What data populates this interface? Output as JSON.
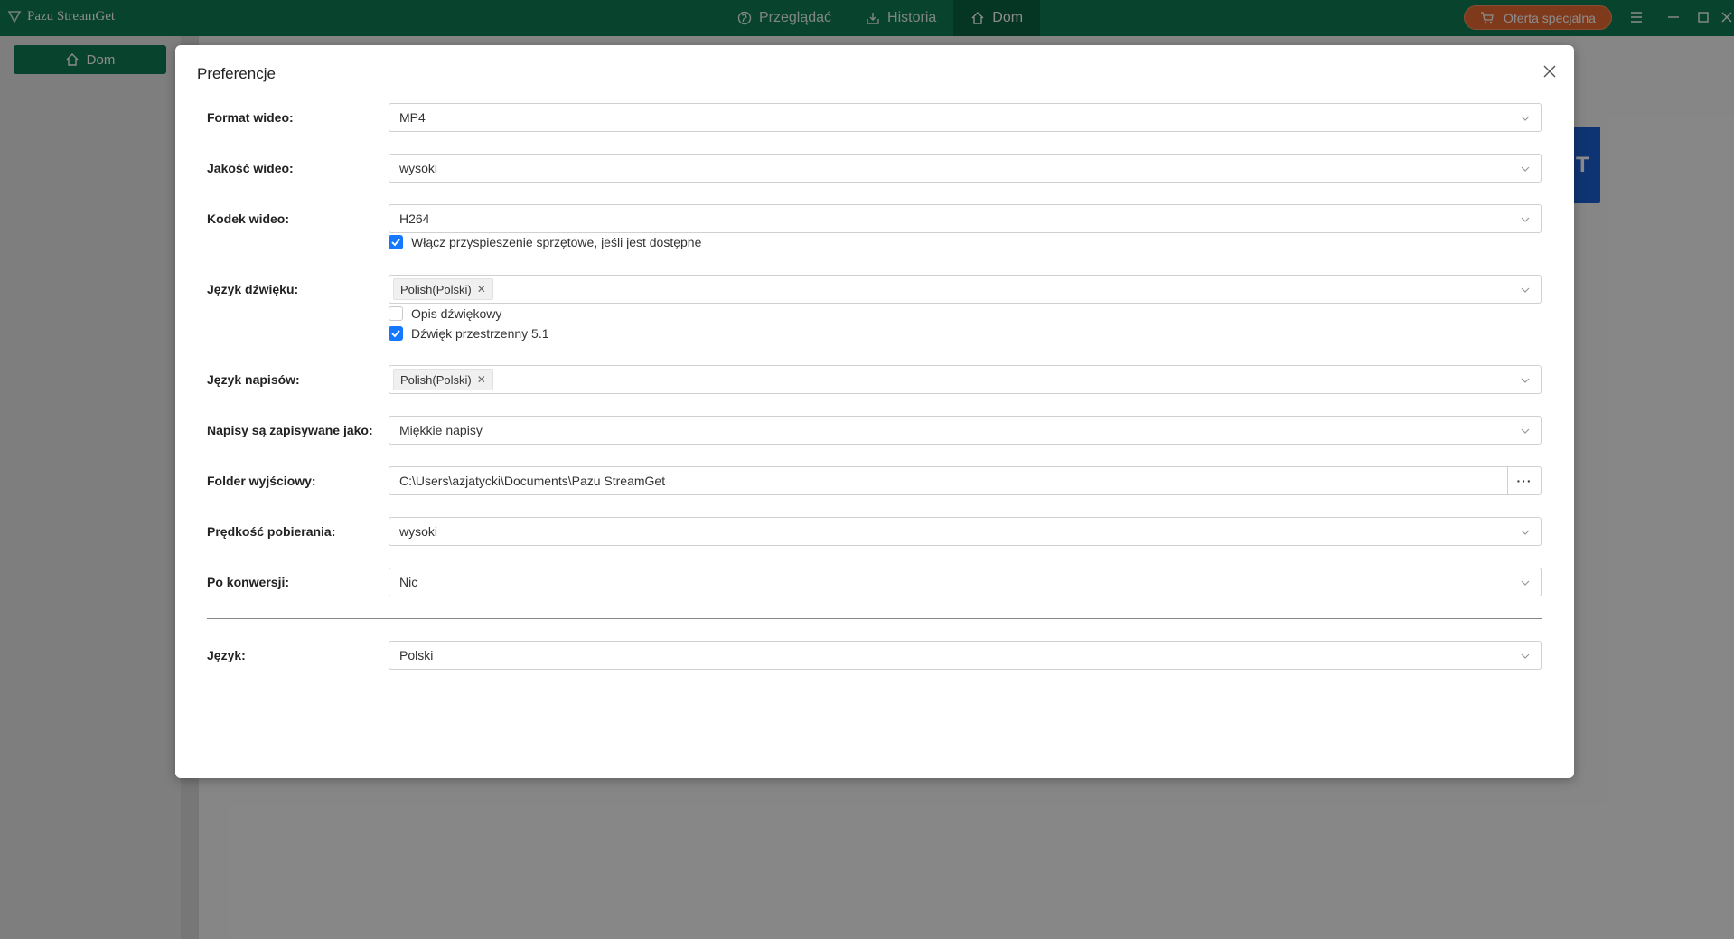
{
  "app": {
    "title": "Pazu StreamGet"
  },
  "nav": {
    "tabs": [
      {
        "label": "Przeglądać",
        "icon": "globe-icon"
      },
      {
        "label": "Historia",
        "icon": "download-icon"
      },
      {
        "label": "Dom",
        "icon": "home-icon",
        "active": true
      }
    ]
  },
  "header": {
    "offer_label": "Oferta specjalna"
  },
  "sidebar": {
    "home_label": "Dom"
  },
  "background": {
    "banner_char": "T"
  },
  "colors": {
    "brand_green": "#0f7a53",
    "offer_orange": "#e86a33",
    "checkbox_blue": "#1677ff"
  },
  "dialog": {
    "title": "Preferencje",
    "video_format": {
      "label": "Format wideo:",
      "value": "MP4"
    },
    "video_quality": {
      "label": "Jakość wideo:",
      "value": "wysoki"
    },
    "video_codec": {
      "label": "Kodek wideo:",
      "value": "H264"
    },
    "hw_accel": {
      "label": "Włącz przyspieszenie sprzętowe, jeśli jest dostępne",
      "checked": true
    },
    "audio_lang": {
      "label": "Język dźwięku:",
      "tag": "Polish(Polski)"
    },
    "audio_description": {
      "label": "Opis dźwiękowy",
      "checked": false
    },
    "surround": {
      "label": "Dźwięk przestrzenny 5.1",
      "checked": true
    },
    "subtitle_lang": {
      "label": "Język napisów:",
      "tag": "Polish(Polski)"
    },
    "subtitle_save": {
      "label": "Napisy są zapisywane jako:",
      "value": "Miękkie napisy"
    },
    "output_folder": {
      "label": "Folder wyjściowy:",
      "value": "C:\\Users\\azjatycki\\Documents\\Pazu StreamGet",
      "browse_label": "···"
    },
    "download_speed": {
      "label": "Prędkość pobierania:",
      "value": "wysoki"
    },
    "after_conversion": {
      "label": "Po konwersji:",
      "value": "Nic"
    },
    "language": {
      "label": "Język:",
      "value": "Polski"
    }
  }
}
